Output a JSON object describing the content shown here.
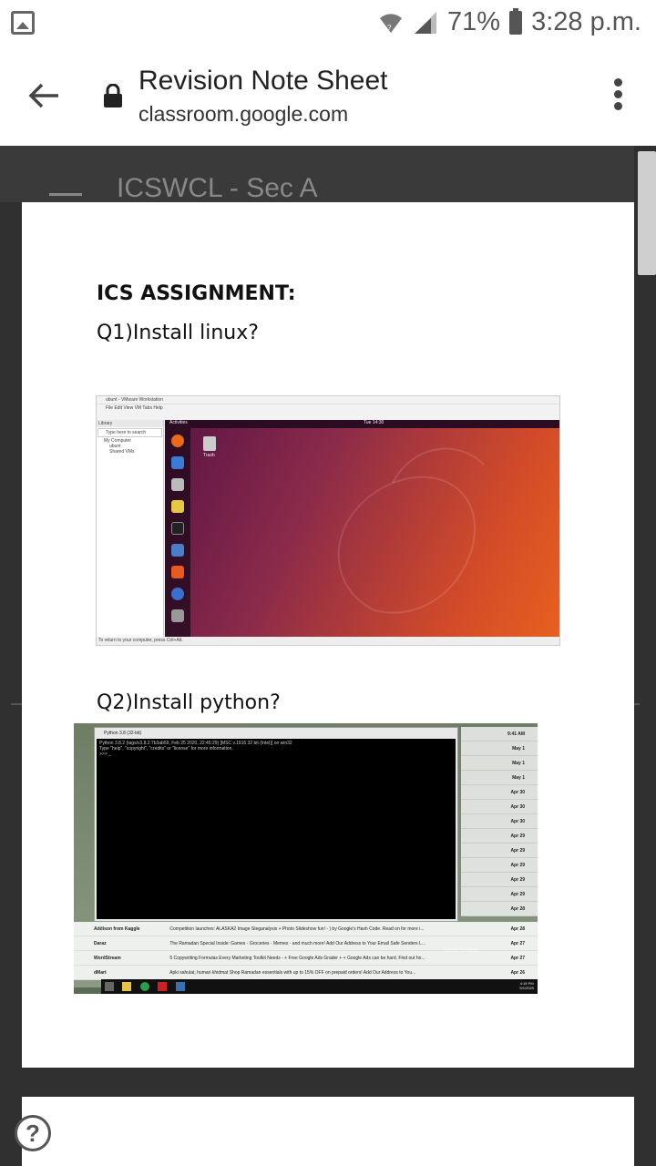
{
  "status_bar": {
    "battery_percent": "71%",
    "time": "3:28 p.m."
  },
  "header": {
    "title": "Revision Note Sheet",
    "url": "classroom.google.com"
  },
  "background": {
    "course_name": "ICSWCL - Sec A"
  },
  "document": {
    "heading": "ICS ASSIGNMENT:",
    "question1": "Q1)Install linux?",
    "question2": "Q2)Install python?"
  },
  "screenshot_linux": {
    "window_title": "ubunt - VMware Workstation",
    "menu": "File  Edit  View  VM  Tabs  Help",
    "library_label": "Library",
    "search_placeholder": "Type here to search",
    "tree_root": "My Computer",
    "tree_vm": "ubunt",
    "tree_shared": "Shared VMs",
    "activities": "Activities",
    "clock": "Tue 14:30",
    "trash": "Trash",
    "status_hint": "To return to your computer, press Ctrl+Alt."
  },
  "screenshot_python": {
    "window_title": "Python 3.8 (32-bit)",
    "line1": "Python 3.8.2 (tags/v3.8.2:7b3ab59, Feb 25 2020, 22:45:29) [MSC v.1916 32 bit (Intel)] on win32",
    "line2": "Type \"help\", \"copyright\", \"credits\" or \"license\" for more information.",
    "prompt": ">>> _",
    "side_dates": [
      "9:41 AM",
      "May 1",
      "May 1",
      "May 1",
      "Apr 30",
      "Apr 30",
      "Apr 30",
      "Apr 29",
      "Apr 29",
      "Apr 29",
      "Apr 29",
      "Apr 29",
      "Apr 28"
    ],
    "emails": [
      {
        "from": "Addison from Kaggle",
        "subject": "Competition launches: ALASKA2 Image Steganalysis + Photo Slideshow fun! - ) by Google's Hash Code. Read on for more i...",
        "date": "Apr 28"
      },
      {
        "from": "Daraz",
        "subject": "The Ramadan Special  Inside: Games · Groceries · Memes · and much more! Add Our Address to Your Email Safe Senders L...",
        "date": "Apr 27"
      },
      {
        "from": "WordStream",
        "subject": "5 Copywriting Formulas Every Marketing Toolkit Needs - + Free Google Ads Grader + + Google Ads can be hard. Find out ho...",
        "date": "Apr 27"
      },
      {
        "from": "dMart",
        "subject": "Apki sahulat, humari khidmat  Shop Ramadan essentials with up to 15% OFF on prepaid orders! Add Our Address to You...",
        "date": "Apr 26"
      }
    ],
    "activate": "Activate Windows",
    "tray_time": "4:19 PM",
    "tray_date": "5/1/2020"
  }
}
